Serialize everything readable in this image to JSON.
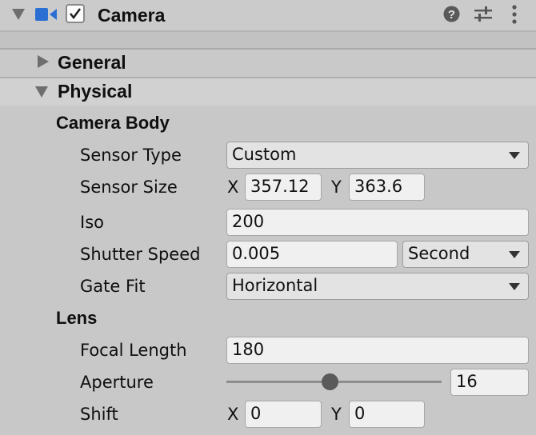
{
  "header": {
    "title": "Camera",
    "enabled": true,
    "icons": [
      "foldout-arrow-icon",
      "camera-icon",
      "help-icon",
      "presets-icon",
      "more-menu-icon"
    ],
    "camera_icon_color": "#2b6ed4"
  },
  "foldouts": {
    "general": {
      "label": "General",
      "expanded": false
    },
    "physical": {
      "label": "Physical",
      "expanded": true
    }
  },
  "camera_body": {
    "section_label": "Camera Body",
    "sensor_type": {
      "label": "Sensor Type",
      "value": "Custom"
    },
    "sensor_size": {
      "label": "Sensor Size",
      "x_label": "X",
      "x": "357.12",
      "y_label": "Y",
      "y": "363.6"
    },
    "iso": {
      "label": "Iso",
      "value": "200"
    },
    "shutter_speed": {
      "label": "Shutter Speed",
      "value": "0.005",
      "unit": "Second"
    },
    "gate_fit": {
      "label": "Gate Fit",
      "value": "Horizontal"
    }
  },
  "lens": {
    "section_label": "Lens",
    "focal_length": {
      "label": "Focal Length",
      "value": "180"
    },
    "aperture": {
      "label": "Aperture",
      "value": "16",
      "slider_fraction": 0.48
    },
    "shift": {
      "label": "Shift",
      "x_label": "X",
      "x": "0",
      "y_label": "Y",
      "y": "0"
    }
  }
}
